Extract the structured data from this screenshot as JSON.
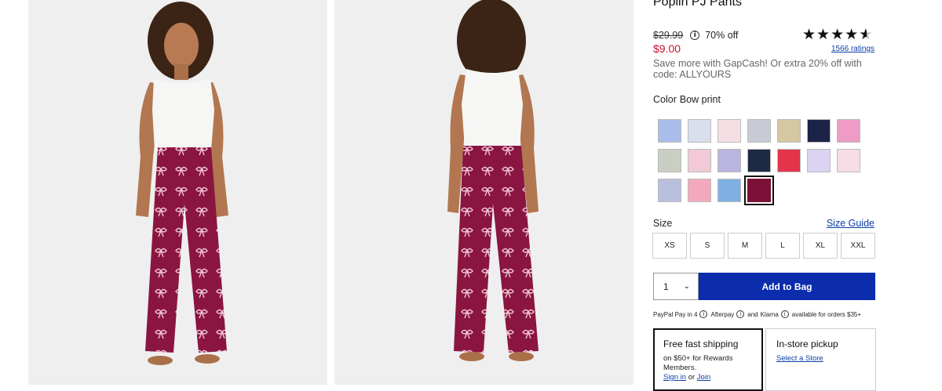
{
  "product": {
    "title": "Poplin PJ Pants",
    "original_price": "$29.99",
    "discount": "70% off",
    "sale_price": "$9.00",
    "promo": "Save more with GapCash! Or extra 20% off with code: ALLYOURS",
    "rating_stars": 4.5,
    "ratings_count": "1566 ratings"
  },
  "color": {
    "label": "Color",
    "selected": "Bow print",
    "swatches": [
      {
        "name": "blue-stripe",
        "color": "#a9bde8"
      },
      {
        "name": "blue-floral",
        "color": "#d9e0ec"
      },
      {
        "name": "pink-hearts",
        "color": "#f6dfe4"
      },
      {
        "name": "gray-heart",
        "color": "#c8cad4"
      },
      {
        "name": "tan-stripe",
        "color": "#d6c7a3"
      },
      {
        "name": "navy-dots",
        "color": "#1b2448"
      },
      {
        "name": "pink-stripe",
        "color": "#ee9cc6"
      },
      {
        "name": "green-plaid",
        "color": "#c9cfc3"
      },
      {
        "name": "pink-cherry",
        "color": "#f2c9d6"
      },
      {
        "name": "lavender-plaid",
        "color": "#b9b4e0"
      },
      {
        "name": "navy-floral",
        "color": "#1d2a44"
      },
      {
        "name": "red-plaid",
        "color": "#e3344b"
      },
      {
        "name": "lilac-print",
        "color": "#dcd2f2"
      },
      {
        "name": "light-pink",
        "color": "#f7dde6"
      },
      {
        "name": "periwinkle-stripe",
        "color": "#b8bfdd"
      },
      {
        "name": "pink-strawberry",
        "color": "#f3a9bd"
      },
      {
        "name": "blue-rainbow",
        "color": "#7fb0e4"
      },
      {
        "name": "bow-print",
        "color": "#7c1137",
        "selected": true
      }
    ]
  },
  "size": {
    "label": "Size",
    "guide": "Size Guide",
    "options": [
      "XS",
      "S",
      "M",
      "L",
      "XL",
      "XXL"
    ]
  },
  "cart": {
    "qty": "1",
    "add_label": "Add to Bag"
  },
  "payment": {
    "paypal": "PayPal Pay in 4",
    "afterpay": "Afterpay",
    "and": "and",
    "klarna": "Klarna",
    "available": "available for orders $35+"
  },
  "shipping": {
    "title": "Free fast shipping",
    "text": "on $50+ for Rewards Members.",
    "sign_in": "Sign in",
    "or": "or",
    "join": "Join"
  },
  "pickup": {
    "title": "In-store pickup",
    "link": "Select a Store"
  },
  "colors": {
    "accent_blue": "#0a2cad",
    "sale_red": "#c0142d",
    "pants": "#8a1540"
  }
}
